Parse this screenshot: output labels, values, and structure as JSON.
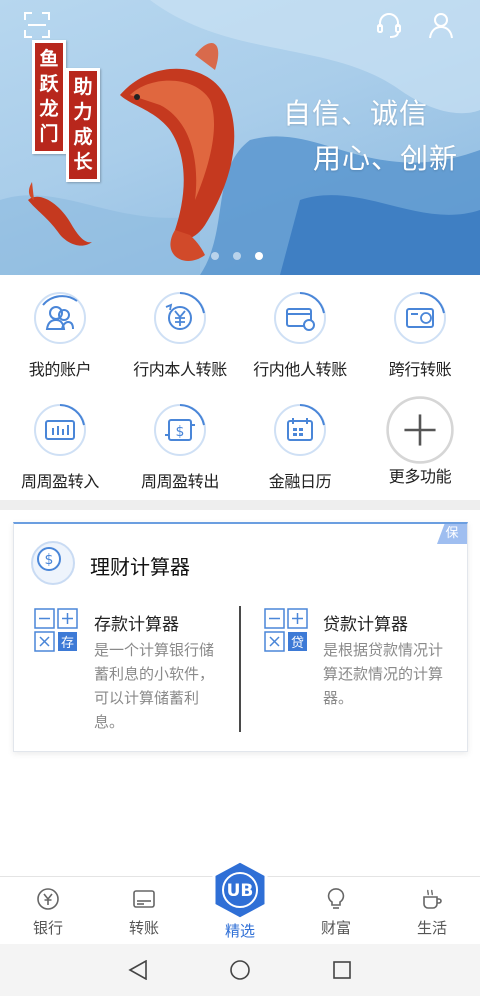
{
  "banner": {
    "tag_left": "鱼跃龙门",
    "tag_right": "助力成长",
    "slogan_line1": "自信、诚信",
    "slogan_line2": "用心、创新",
    "dots": 3,
    "active_dot": 2
  },
  "header": {
    "scan_icon": "scan-icon",
    "service_icon": "headset-icon",
    "profile_icon": "user-icon"
  },
  "functions": [
    {
      "label": "我的账户",
      "icon": "account-icon"
    },
    {
      "label": "行内本人转账",
      "icon": "yuan-transfer-icon"
    },
    {
      "label": "行内他人转账",
      "icon": "card-transfer-icon"
    },
    {
      "label": "跨行转账",
      "icon": "interbank-icon"
    },
    {
      "label": "周周盈转入",
      "icon": "chart-in-icon"
    },
    {
      "label": "周周盈转出",
      "icon": "dollar-out-icon"
    },
    {
      "label": "金融日历",
      "icon": "calendar-icon"
    },
    {
      "label": "更多功能",
      "icon": "plus-icon"
    }
  ],
  "calculator_card": {
    "badge": "保",
    "title": "理财计算器",
    "deposit": {
      "title": "存款计算器",
      "icon_char": "存",
      "desc": "是一个计算银行储蓄利息的小软件，可以计算储蓄利息。"
    },
    "loan": {
      "title": "贷款计算器",
      "icon_char": "贷",
      "desc": "是根据贷款情况计算还款情况的计算器。"
    }
  },
  "tabbar": {
    "tabs": [
      {
        "label": "银行",
        "icon": "bank-icon"
      },
      {
        "label": "转账",
        "icon": "transfer-icon"
      },
      {
        "label": "精选",
        "icon": "ub-logo-icon"
      },
      {
        "label": "财富",
        "icon": "bulb-icon"
      },
      {
        "label": "生活",
        "icon": "coffee-icon"
      }
    ],
    "center_text": "UB",
    "active_index": 2
  },
  "colors": {
    "accent": "#2f6fd6",
    "banner_blue": "#a9cdea",
    "tag_red": "#b8271c"
  }
}
